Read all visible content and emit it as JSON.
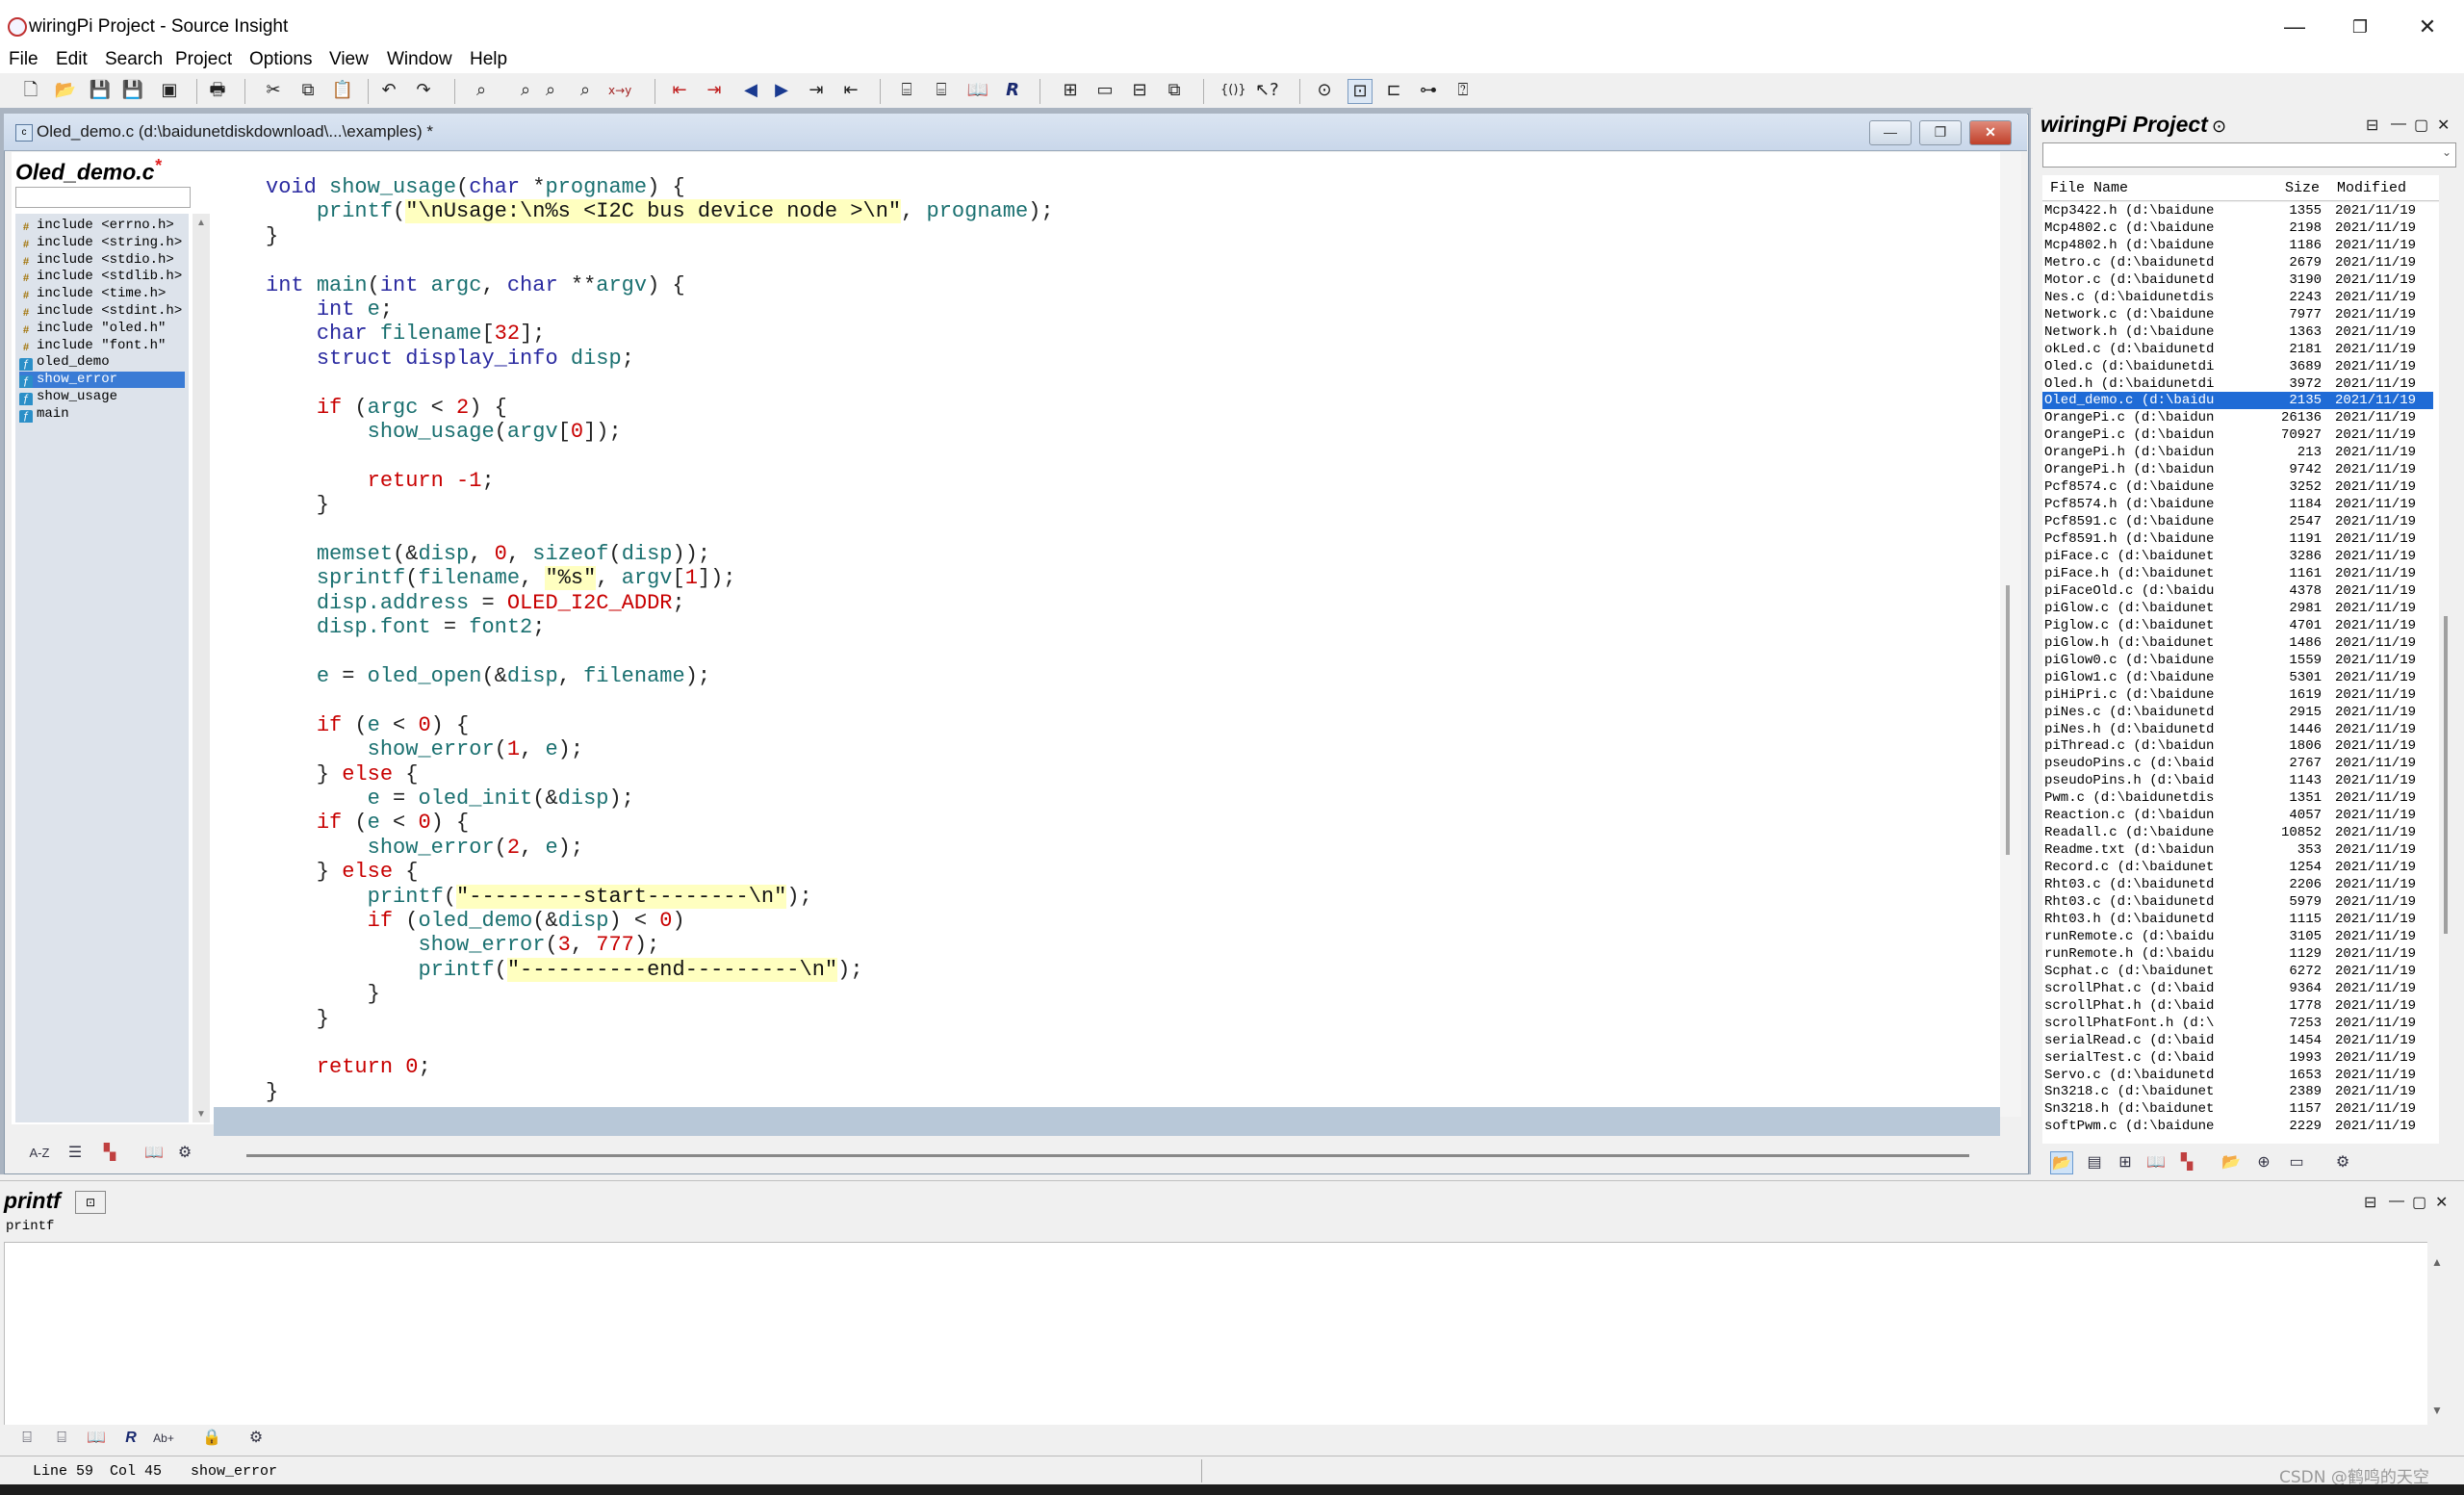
{
  "window": {
    "title": "wiringPi Project - Source Insight",
    "buttons": [
      "—",
      "❐",
      "✕"
    ]
  },
  "menu": [
    "File",
    "Edit",
    "Search",
    "Project",
    "Options",
    "View",
    "Window",
    "Help"
  ],
  "document": {
    "title": "Oled_demo.c (d:\\baidunetdiskdownload\\...\\examples) *",
    "file_name": "Oled_demo.c",
    "modified_mark": "*"
  },
  "symbols": [
    {
      "icon": "include",
      "label": "include <errno.h>"
    },
    {
      "icon": "include",
      "label": "include <string.h>"
    },
    {
      "icon": "include",
      "label": "include <stdio.h>"
    },
    {
      "icon": "include",
      "label": "include <stdlib.h>"
    },
    {
      "icon": "include",
      "label": "include <time.h>"
    },
    {
      "icon": "include",
      "label": "include <stdint.h>"
    },
    {
      "icon": "include",
      "label": "include \"oled.h\""
    },
    {
      "icon": "include",
      "label": "include \"font.h\""
    },
    {
      "icon": "function",
      "label": "oled_demo"
    },
    {
      "icon": "function",
      "label": "show_error",
      "selected": true
    },
    {
      "icon": "function",
      "label": "show_usage"
    },
    {
      "icon": "function",
      "label": "main"
    }
  ],
  "code": [
    [
      [
        "kw",
        "void "
      ],
      [
        "fnn",
        "show_usage"
      ],
      [
        "p",
        "("
      ],
      [
        "tp",
        "char "
      ],
      [
        "p",
        "*"
      ],
      [
        "id",
        "progname"
      ],
      [
        "p",
        ") {"
      ]
    ],
    [
      [
        "p",
        "    "
      ],
      [
        "fnn",
        "printf"
      ],
      [
        "p",
        "("
      ],
      [
        "str",
        "\"\\nUsage:\\n%s <I2C bus device node >\\n\""
      ],
      [
        "p",
        ", "
      ],
      [
        "id",
        "progname"
      ],
      [
        "p",
        ");"
      ]
    ],
    [
      [
        "p",
        "}"
      ]
    ],
    [],
    [
      [
        "kw",
        "int "
      ],
      [
        "fnn",
        "main"
      ],
      [
        "p",
        "("
      ],
      [
        "tp",
        "int "
      ],
      [
        "id",
        "argc"
      ],
      [
        "p",
        ", "
      ],
      [
        "tp",
        "char "
      ],
      [
        "p",
        "**"
      ],
      [
        "id",
        "argv"
      ],
      [
        "p",
        ") {"
      ]
    ],
    [
      [
        "p",
        "    "
      ],
      [
        "kw",
        "int "
      ],
      [
        "id",
        "e"
      ],
      [
        "p",
        ";"
      ]
    ],
    [
      [
        "p",
        "    "
      ],
      [
        "tp",
        "char "
      ],
      [
        "id",
        "filename"
      ],
      [
        "p",
        "["
      ],
      [
        "num",
        "32"
      ],
      [
        "p",
        "];"
      ]
    ],
    [
      [
        "p",
        "    "
      ],
      [
        "tp",
        "struct "
      ],
      [
        "tp",
        "display_info "
      ],
      [
        "id",
        "disp"
      ],
      [
        "p",
        ";"
      ]
    ],
    [],
    [
      [
        "p",
        "    "
      ],
      [
        "ctl",
        "if "
      ],
      [
        "p",
        "("
      ],
      [
        "id",
        "argc"
      ],
      [
        "p",
        " < "
      ],
      [
        "num",
        "2"
      ],
      [
        "p",
        ") {"
      ]
    ],
    [
      [
        "p",
        "        "
      ],
      [
        "fnn",
        "show_usage"
      ],
      [
        "p",
        "("
      ],
      [
        "id",
        "argv"
      ],
      [
        "p",
        "["
      ],
      [
        "num",
        "0"
      ],
      [
        "p",
        "]);"
      ]
    ],
    [],
    [
      [
        "p",
        "        "
      ],
      [
        "ctl",
        "return "
      ],
      [
        "num",
        "-1"
      ],
      [
        "p",
        ";"
      ]
    ],
    [
      [
        "p",
        "    }"
      ]
    ],
    [],
    [
      [
        "p",
        "    "
      ],
      [
        "fnn",
        "memset"
      ],
      [
        "p",
        "(&"
      ],
      [
        "id",
        "disp"
      ],
      [
        "p",
        ", "
      ],
      [
        "num",
        "0"
      ],
      [
        "p",
        ", "
      ],
      [
        "id",
        "sizeof"
      ],
      [
        "p",
        "("
      ],
      [
        "id",
        "disp"
      ],
      [
        "p",
        "));"
      ]
    ],
    [
      [
        "p",
        "    "
      ],
      [
        "fnn",
        "sprintf"
      ],
      [
        "p",
        "("
      ],
      [
        "id",
        "filename"
      ],
      [
        "p",
        ", "
      ],
      [
        "str",
        "\"%s\""
      ],
      [
        "p",
        ", "
      ],
      [
        "id",
        "argv"
      ],
      [
        "p",
        "["
      ],
      [
        "num",
        "1"
      ],
      [
        "p",
        "]);"
      ]
    ],
    [
      [
        "p",
        "    "
      ],
      [
        "id",
        "disp.address"
      ],
      [
        "p",
        " = "
      ],
      [
        "mac",
        "OLED_I2C_ADDR"
      ],
      [
        "p",
        ";"
      ]
    ],
    [
      [
        "p",
        "    "
      ],
      [
        "id",
        "disp.font"
      ],
      [
        "p",
        " = "
      ],
      [
        "id",
        "font2"
      ],
      [
        "p",
        ";"
      ]
    ],
    [],
    [
      [
        "p",
        "    "
      ],
      [
        "id",
        "e"
      ],
      [
        "p",
        " = "
      ],
      [
        "fnn",
        "oled_open"
      ],
      [
        "p",
        "(&"
      ],
      [
        "id",
        "disp"
      ],
      [
        "p",
        ", "
      ],
      [
        "id",
        "filename"
      ],
      [
        "p",
        ");"
      ]
    ],
    [],
    [
      [
        "p",
        "    "
      ],
      [
        "ctl",
        "if "
      ],
      [
        "p",
        "("
      ],
      [
        "id",
        "e"
      ],
      [
        "p",
        " < "
      ],
      [
        "num",
        "0"
      ],
      [
        "p",
        ") {"
      ]
    ],
    [
      [
        "p",
        "        "
      ],
      [
        "fnn",
        "show_error"
      ],
      [
        "p",
        "("
      ],
      [
        "num",
        "1"
      ],
      [
        "p",
        ", "
      ],
      [
        "id",
        "e"
      ],
      [
        "p",
        ");"
      ]
    ],
    [
      [
        "p",
        "    } "
      ],
      [
        "ctl",
        "else"
      ],
      [
        "p",
        " {"
      ]
    ],
    [
      [
        "p",
        "        "
      ],
      [
        "id",
        "e"
      ],
      [
        "p",
        " = "
      ],
      [
        "fnn",
        "oled_init"
      ],
      [
        "p",
        "(&"
      ],
      [
        "id",
        "disp"
      ],
      [
        "p",
        ");"
      ]
    ],
    [
      [
        "p",
        "    "
      ],
      [
        "ctl",
        "if "
      ],
      [
        "p",
        "("
      ],
      [
        "id",
        "e"
      ],
      [
        "p",
        " < "
      ],
      [
        "num",
        "0"
      ],
      [
        "p",
        ") {"
      ]
    ],
    [
      [
        "p",
        "        "
      ],
      [
        "fnn",
        "show_error"
      ],
      [
        "p",
        "("
      ],
      [
        "num",
        "2"
      ],
      [
        "p",
        ", "
      ],
      [
        "id",
        "e"
      ],
      [
        "p",
        ");"
      ]
    ],
    [
      [
        "p",
        "    } "
      ],
      [
        "ctl",
        "else"
      ],
      [
        "p",
        " {"
      ]
    ],
    [
      [
        "p",
        "        "
      ],
      [
        "fnn",
        "printf"
      ],
      [
        "p",
        "("
      ],
      [
        "str",
        "\"---------start--------\\n\""
      ],
      [
        "p",
        ");"
      ]
    ],
    [
      [
        "p",
        "        "
      ],
      [
        "ctl",
        "if "
      ],
      [
        "p",
        "("
      ],
      [
        "fnn",
        "oled_demo"
      ],
      [
        "p",
        "(&"
      ],
      [
        "id",
        "disp"
      ],
      [
        "p",
        ") < "
      ],
      [
        "num",
        "0"
      ],
      [
        "p",
        ")"
      ]
    ],
    [
      [
        "p",
        "            "
      ],
      [
        "fnn",
        "show_error"
      ],
      [
        "p",
        "("
      ],
      [
        "num",
        "3"
      ],
      [
        "p",
        ", "
      ],
      [
        "num",
        "777"
      ],
      [
        "p",
        ");"
      ]
    ],
    [
      [
        "p",
        "            "
      ],
      [
        "fnn",
        "printf"
      ],
      [
        "p",
        "("
      ],
      [
        "str",
        "\"----------end---------\\n\""
      ],
      [
        "p",
        ");"
      ]
    ],
    [
      [
        "p",
        "        }"
      ]
    ],
    [
      [
        "p",
        "    }"
      ]
    ],
    [],
    [
      [
        "p",
        "    "
      ],
      [
        "ctl",
        "return "
      ],
      [
        "num",
        "0"
      ],
      [
        "p",
        ";"
      ]
    ],
    [
      [
        "p",
        "}"
      ]
    ]
  ],
  "project": {
    "title": "wiringPi Project",
    "headers": {
      "name": "File Name",
      "size": "Size",
      "modified": "Modified"
    },
    "files": [
      [
        "Mcp3422.h (d:\\baidune",
        "1355",
        "2021/11/19"
      ],
      [
        "Mcp4802.c (d:\\baidune",
        "2198",
        "2021/11/19"
      ],
      [
        "Mcp4802.h (d:\\baidune",
        "1186",
        "2021/11/19"
      ],
      [
        "Metro.c (d:\\baidunetd",
        "2679",
        "2021/11/19"
      ],
      [
        "Motor.c (d:\\baidunetd",
        "3190",
        "2021/11/19"
      ],
      [
        "Nes.c (d:\\baidunetdis",
        "2243",
        "2021/11/19"
      ],
      [
        "Network.c (d:\\baidune",
        "7977",
        "2021/11/19"
      ],
      [
        "Network.h (d:\\baidune",
        "1363",
        "2021/11/19"
      ],
      [
        "okLed.c (d:\\baidunetd",
        "2181",
        "2021/11/19"
      ],
      [
        "Oled.c (d:\\baidunetdi",
        "3689",
        "2021/11/19"
      ],
      [
        "Oled.h (d:\\baidunetdi",
        "3972",
        "2021/11/19"
      ],
      [
        "Oled_demo.c (d:\\baidu",
        "2135",
        "2021/11/19",
        "sel"
      ],
      [
        "OrangePi.c (d:\\baidun",
        "26136",
        "2021/11/19"
      ],
      [
        "OrangePi.c (d:\\baidun",
        "70927",
        "2021/11/19"
      ],
      [
        "OrangePi.h (d:\\baidun",
        "213",
        "2021/11/19"
      ],
      [
        "OrangePi.h (d:\\baidun",
        "9742",
        "2021/11/19"
      ],
      [
        "Pcf8574.c (d:\\baidune",
        "3252",
        "2021/11/19"
      ],
      [
        "Pcf8574.h (d:\\baidune",
        "1184",
        "2021/11/19"
      ],
      [
        "Pcf8591.c (d:\\baidune",
        "2547",
        "2021/11/19"
      ],
      [
        "Pcf8591.h (d:\\baidune",
        "1191",
        "2021/11/19"
      ],
      [
        "piFace.c (d:\\baidunet",
        "3286",
        "2021/11/19"
      ],
      [
        "piFace.h (d:\\baidunet",
        "1161",
        "2021/11/19"
      ],
      [
        "piFaceOld.c (d:\\baidu",
        "4378",
        "2021/11/19"
      ],
      [
        "piGlow.c (d:\\baidunet",
        "2981",
        "2021/11/19"
      ],
      [
        "Piglow.c (d:\\baidunet",
        "4701",
        "2021/11/19"
      ],
      [
        "piGlow.h (d:\\baidunet",
        "1486",
        "2021/11/19"
      ],
      [
        "piGlow0.c (d:\\baidune",
        "1559",
        "2021/11/19"
      ],
      [
        "piGlow1.c (d:\\baidune",
        "5301",
        "2021/11/19"
      ],
      [
        "piHiPri.c (d:\\baidune",
        "1619",
        "2021/11/19"
      ],
      [
        "piNes.c (d:\\baidunetd",
        "2915",
        "2021/11/19"
      ],
      [
        "piNes.h (d:\\baidunetd",
        "1446",
        "2021/11/19"
      ],
      [
        "piThread.c (d:\\baidun",
        "1806",
        "2021/11/19"
      ],
      [
        "pseudoPins.c (d:\\baid",
        "2767",
        "2021/11/19"
      ],
      [
        "pseudoPins.h (d:\\baid",
        "1143",
        "2021/11/19"
      ],
      [
        "Pwm.c (d:\\baidunetdis",
        "1351",
        "2021/11/19"
      ],
      [
        "Reaction.c (d:\\baidun",
        "4057",
        "2021/11/19"
      ],
      [
        "Readall.c (d:\\baidune",
        "10852",
        "2021/11/19"
      ],
      [
        "Readme.txt (d:\\baidun",
        "353",
        "2021/11/19"
      ],
      [
        "Record.c (d:\\baidunet",
        "1254",
        "2021/11/19"
      ],
      [
        "Rht03.c (d:\\baidunetd",
        "2206",
        "2021/11/19"
      ],
      [
        "Rht03.c (d:\\baidunetd",
        "5979",
        "2021/11/19"
      ],
      [
        "Rht03.h (d:\\baidunetd",
        "1115",
        "2021/11/19"
      ],
      [
        "runRemote.c (d:\\baidu",
        "3105",
        "2021/11/19"
      ],
      [
        "runRemote.h (d:\\baidu",
        "1129",
        "2021/11/19"
      ],
      [
        "Scphat.c (d:\\baidunet",
        "6272",
        "2021/11/19"
      ],
      [
        "scrollPhat.c (d:\\baid",
        "9364",
        "2021/11/19"
      ],
      [
        "scrollPhat.h (d:\\baid",
        "1778",
        "2021/11/19"
      ],
      [
        "scrollPhatFont.h (d:\\",
        "7253",
        "2021/11/19"
      ],
      [
        "serialRead.c (d:\\baid",
        "1454",
        "2021/11/19"
      ],
      [
        "serialTest.c (d:\\baid",
        "1993",
        "2021/11/19"
      ],
      [
        "Servo.c (d:\\baidunetd",
        "1653",
        "2021/11/19"
      ],
      [
        "Sn3218.c (d:\\baidunet",
        "2389",
        "2021/11/19"
      ],
      [
        "Sn3218.h (d:\\baidunet",
        "1157",
        "2021/11/19"
      ],
      [
        "softPwm.c (d:\\baidune",
        "2229",
        "2021/11/19"
      ]
    ]
  },
  "context": {
    "title": "printf",
    "symbol": "printf"
  },
  "status": {
    "line": "Line 59",
    "col": "Col 45",
    "symbol": "show_error"
  },
  "watermark": "CSDN @鹤鸣的天空"
}
